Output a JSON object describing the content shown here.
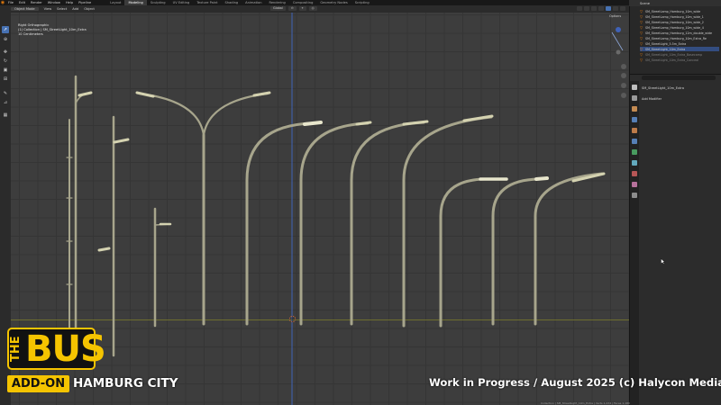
{
  "menubar": {
    "items": [
      "File",
      "Edit",
      "Render",
      "Window",
      "Help",
      "Pipeline"
    ],
    "workspaces": [
      "Layout",
      "Modeling",
      "Sculpting",
      "UV Editing",
      "Texture Paint",
      "Shading",
      "Animation",
      "Rendering",
      "Compositing",
      "Geometry Nodes",
      "Scripting"
    ],
    "active_workspace": "Modeling",
    "logo_icon": "blender-logo-icon"
  },
  "header": {
    "mode": "Object Mode",
    "menus": [
      "View",
      "Select",
      "Add",
      "Object"
    ],
    "transform_orientation": "Global"
  },
  "viewport": {
    "info": [
      "Right Orthographic",
      "(1) Collection | SM_StreetLight_10m_Extra",
      "10 Centimeters"
    ],
    "options_label": "Options"
  },
  "outliner": {
    "title": "Scene",
    "rows": [
      {
        "label": "SM_StreetLamp_Hamburg_10m_wide",
        "selected": false,
        "dim": false
      },
      {
        "label": "SM_StreetLamp_Hamburg_10m_wide_1",
        "selected": false,
        "dim": false
      },
      {
        "label": "SM_StreetLamp_Hamburg_10m_wide_2",
        "selected": false,
        "dim": false
      },
      {
        "label": "SM_StreetLamp_Hamburg_10m_wide_4",
        "selected": false,
        "dim": false
      },
      {
        "label": "SM_StreetLamp_Hamburg_12m_double_wide",
        "selected": false,
        "dim": false
      },
      {
        "label": "SM_StreetLamp_Hamburg_10m_Extra_Re",
        "selected": false,
        "dim": false
      },
      {
        "label": "SM_StreetLight_5.5m_Extra",
        "selected": false,
        "dim": false
      },
      {
        "label": "SM_StreetLight_10m_Extra",
        "selected": true,
        "dim": false
      },
      {
        "label": "SM_StreetLight_10m_Extra_Basecamp",
        "selected": false,
        "dim": true
      },
      {
        "label": "SM_StreetLight_10m_Extra_Conceal",
        "selected": false,
        "dim": true
      }
    ]
  },
  "properties": {
    "object_name": "SM_StreetLight_10m_Extra",
    "add_modifier": "Add Modifier",
    "tab_colors": [
      "#d9d9d9",
      "#b0b0b0",
      "#e09e5a",
      "#5f8fd0",
      "#d88b50",
      "#5f8fd0",
      "#4fb06a",
      "#6fc1d8",
      "#d05f5f",
      "#d07fb0",
      "#9f9f9f"
    ]
  },
  "branding": {
    "logo_the": "THE",
    "logo_bus": "BUS",
    "addon": "ADD-ON",
    "city": "HAMBURG CITY",
    "wip": "Work in Progress / August 2025  (c) Halycon Media",
    "accent": "#f5c400"
  },
  "status_bar": "Collection | SM_StreetLight_10m_Extra | Verts 1,234 | Faces 1,180",
  "colors": {
    "viewport_bg": "#3d3d3d",
    "lamp": "#a7a58c",
    "lamp_head": "#d4d2b0",
    "ground_line": "#6e6e2e",
    "z_axis": "#3f62b8",
    "selection": "#4772b3"
  }
}
